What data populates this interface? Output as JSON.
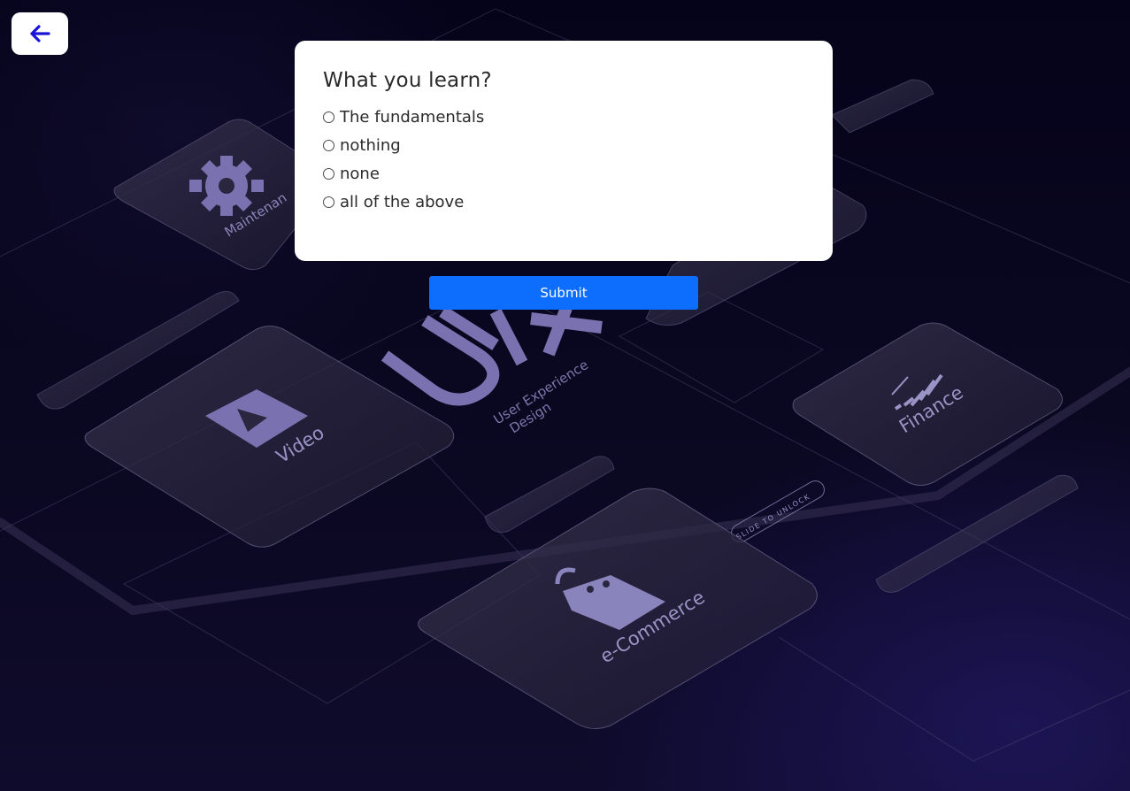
{
  "nav": {
    "back_icon": "arrow-left-icon",
    "accent": "#1a14d6"
  },
  "quiz": {
    "question": "What you learn?",
    "options": [
      {
        "label": "The fundamentals",
        "selected": false
      },
      {
        "label": "nothing",
        "selected": false
      },
      {
        "label": "none",
        "selected": false
      },
      {
        "label": "all of the above",
        "selected": false
      }
    ],
    "submit_label": "Submit",
    "submit_color": "#0d6efd"
  },
  "background": {
    "tiles": [
      {
        "label": "Maintenance",
        "icon": "gear-icon"
      },
      {
        "label": "Video",
        "icon": "play-icon"
      },
      {
        "label": "Finance",
        "icon": "chart-bars-icon"
      },
      {
        "label": "e-Commerce",
        "icon": "shopping-bag-icon"
      }
    ],
    "hero_text": "UX",
    "hero_subtitle_line1": "User Experience",
    "hero_subtitle_line2": "Design",
    "slider_text": "SLIDE TO UNLOCK",
    "tile_accent": "#7a72b0"
  }
}
